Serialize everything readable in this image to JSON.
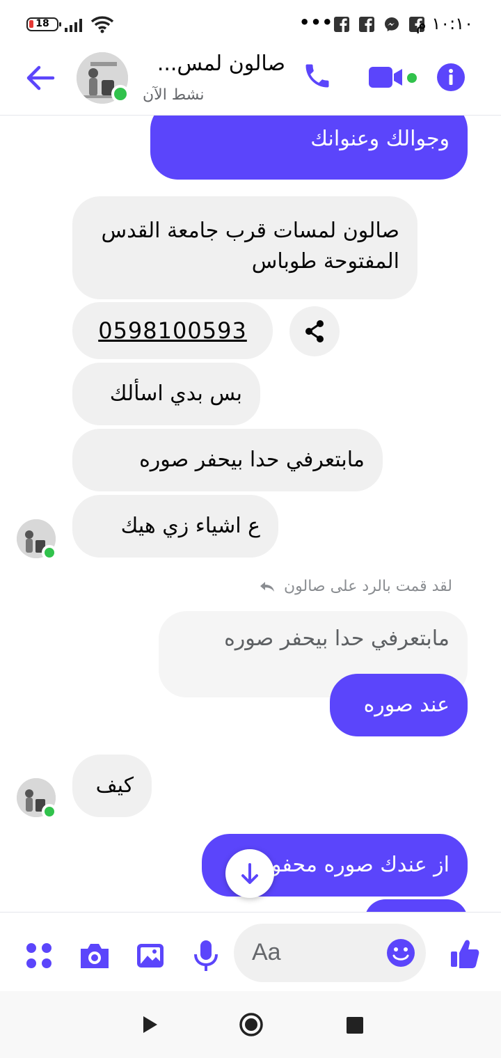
{
  "status_bar": {
    "battery": "18",
    "dots": "•••",
    "time": "١٠:١٠ م"
  },
  "header": {
    "title": "صالون لمس...",
    "subtitle": "نشط الآن"
  },
  "messages": {
    "m1": "وجوالك وعنوانك",
    "m2": "صالون لمسات قرب جامعة القدس المفتوحة طوباس",
    "phone": "0598100593",
    "m3": "بس بدي اسألك",
    "m4": "مابتعرفي حدا بيحفر صوره",
    "m5": "ع اشياء زي هيك",
    "reply_note": "لقد قمت بالرد على صالون",
    "reply_quote": "مابتعرفي حدا بيحفر صوره",
    "m6": "عند صوره",
    "m7": "كيف",
    "m8": "از عندك صوره محفوره"
  },
  "composer": {
    "placeholder": "Aa"
  },
  "colors": {
    "accent": "#5b45fb",
    "incoming_bubble": "#f0f0f0",
    "online": "#31c24c"
  }
}
